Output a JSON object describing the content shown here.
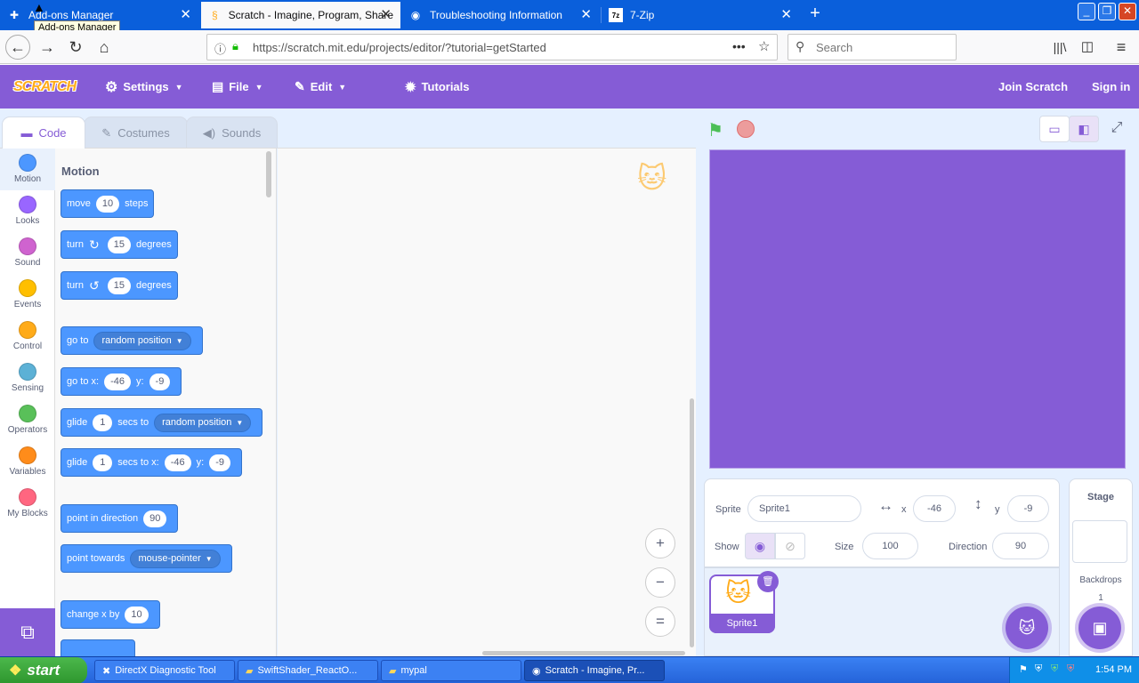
{
  "browser": {
    "tabs": [
      {
        "title": "Add-ons Manager",
        "icon": "puzzle-icon"
      },
      {
        "title": "Scratch - Imagine, Program, Share",
        "icon": "scratch-icon"
      },
      {
        "title": "Troubleshooting Information",
        "icon": "firefox-icon"
      },
      {
        "title": "7-Zip",
        "icon": "7zip-icon"
      }
    ],
    "tooltip": "Add-ons Manager",
    "url": "https://scratch.mit.edu/projects/editor/?tutorial=getStarted",
    "search_placeholder": "Search"
  },
  "scratch": {
    "logo": "SCRATCH",
    "menu": {
      "settings": "Settings",
      "file": "File",
      "edit": "Edit",
      "tutorials": "Tutorials",
      "join": "Join Scratch",
      "signin": "Sign in"
    },
    "editor_tabs": [
      "Code",
      "Costumes",
      "Sounds"
    ],
    "categories": [
      {
        "label": "Motion",
        "color": "#4c97ff"
      },
      {
        "label": "Looks",
        "color": "#9966ff"
      },
      {
        "label": "Sound",
        "color": "#cf63cf"
      },
      {
        "label": "Events",
        "color": "#ffbf00"
      },
      {
        "label": "Control",
        "color": "#ffab19"
      },
      {
        "label": "Sensing",
        "color": "#5cb1d6"
      },
      {
        "label": "Operators",
        "color": "#59c059"
      },
      {
        "label": "Variables",
        "color": "#ff8c1a"
      },
      {
        "label": "My Blocks",
        "color": "#ff6680"
      }
    ],
    "palette_heading": "Motion",
    "blocks": {
      "move": {
        "a": "move",
        "v": "10",
        "b": "steps"
      },
      "turn_right": {
        "a": "turn",
        "v": "15",
        "b": "degrees"
      },
      "turn_left": {
        "a": "turn",
        "v": "15",
        "b": "degrees"
      },
      "goto": {
        "a": "go to",
        "dd": "random position"
      },
      "gotoxy": {
        "a": "go to x:",
        "x": "-46",
        "b": "y:",
        "y": "-9"
      },
      "glide": {
        "a": "glide",
        "v": "1",
        "b": "secs to",
        "dd": "random position"
      },
      "glidexy": {
        "a": "glide",
        "v": "1",
        "b": "secs to x:",
        "x": "-46",
        "c": "y:",
        "y": "-9"
      },
      "point_dir": {
        "a": "point in direction",
        "v": "90"
      },
      "point_towards": {
        "a": "point towards",
        "dd": "mouse-pointer"
      },
      "change_x": {
        "a": "change x by",
        "v": "10"
      }
    },
    "zoom": {
      "in": "+",
      "out": "−",
      "reset": "="
    },
    "sprite_info": {
      "sprite_label": "Sprite",
      "sprite_name": "Sprite1",
      "x_label": "x",
      "x": "-46",
      "y_label": "y",
      "y": "-9",
      "show_label": "Show",
      "size_label": "Size",
      "size": "100",
      "direction_label": "Direction",
      "direction": "90"
    },
    "sprites": [
      {
        "name": "Sprite1"
      }
    ],
    "stage_pane": {
      "title": "Stage",
      "backdrops_label": "Backdrops",
      "backdrops_count": "1"
    },
    "colors": {
      "accent": "#855cd6",
      "motion": "#4c97ff",
      "bg": "#e5f0ff"
    }
  },
  "taskbar": {
    "start": "start",
    "items": [
      "DirectX Diagnostic Tool",
      "SwiftShader_ReactO...",
      "mypal",
      "Scratch - Imagine, Pr..."
    ],
    "clock": "1:54 PM"
  }
}
